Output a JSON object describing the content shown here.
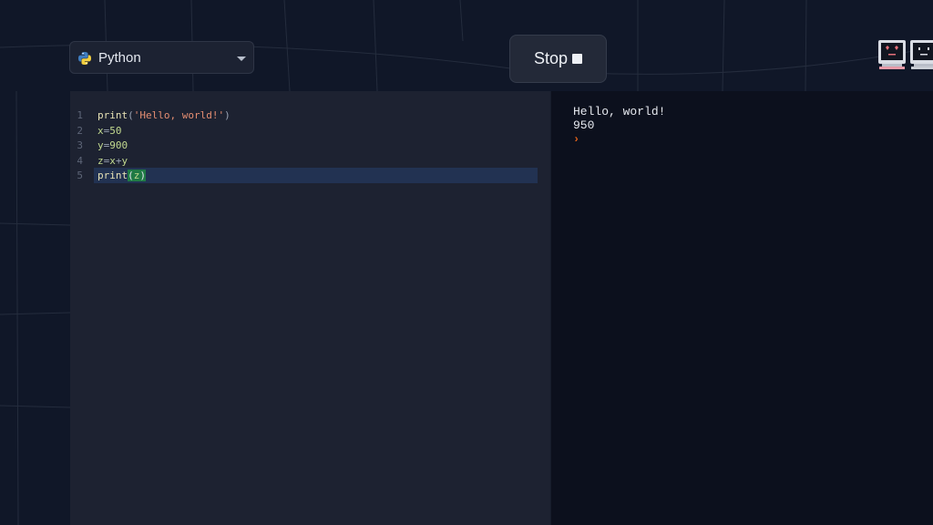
{
  "language_select": {
    "selected": "Python",
    "icon": "python-icon"
  },
  "run_control": {
    "label": "Stop",
    "icon": "stop-square-icon"
  },
  "avatars": [
    {
      "icon": "heart-eyes-computer-icon"
    },
    {
      "icon": "neutral-face-computer-icon"
    }
  ],
  "editor": {
    "lines": [
      {
        "num": "1",
        "tokens": [
          {
            "t": "print",
            "c": "fn"
          },
          {
            "t": "(",
            "c": "op"
          },
          {
            "t": "'Hello, world!'",
            "c": "str"
          },
          {
            "t": ")",
            "c": "op"
          }
        ]
      },
      {
        "num": "2",
        "tokens": [
          {
            "t": "x",
            "c": "var"
          },
          {
            "t": "=",
            "c": "op"
          },
          {
            "t": "50",
            "c": "num"
          }
        ]
      },
      {
        "num": "3",
        "tokens": [
          {
            "t": "y",
            "c": "var"
          },
          {
            "t": "=",
            "c": "op"
          },
          {
            "t": "900",
            "c": "num"
          }
        ]
      },
      {
        "num": "4",
        "tokens": [
          {
            "t": "z",
            "c": "var"
          },
          {
            "t": "=",
            "c": "op"
          },
          {
            "t": "x",
            "c": "var"
          },
          {
            "t": "+",
            "c": "op"
          },
          {
            "t": "y",
            "c": "var"
          }
        ]
      },
      {
        "num": "5",
        "tokens": [
          {
            "t": "print",
            "c": "fn"
          },
          {
            "t": "(",
            "c": "paren-hl"
          },
          {
            "t": "z",
            "c": "cursor-char"
          },
          {
            "t": ")",
            "c": "paren-hl"
          }
        ]
      }
    ],
    "active_line": 5
  },
  "console": {
    "output": [
      "Hello, world!",
      "950"
    ],
    "prompt_symbol": "›"
  },
  "colors": {
    "background": "#101728",
    "editor_bg": "#1d2231",
    "console_bg": "#0c101d",
    "active_line": "#223252",
    "bracket_match": "#1f7a45",
    "prompt": "#e0621b"
  }
}
